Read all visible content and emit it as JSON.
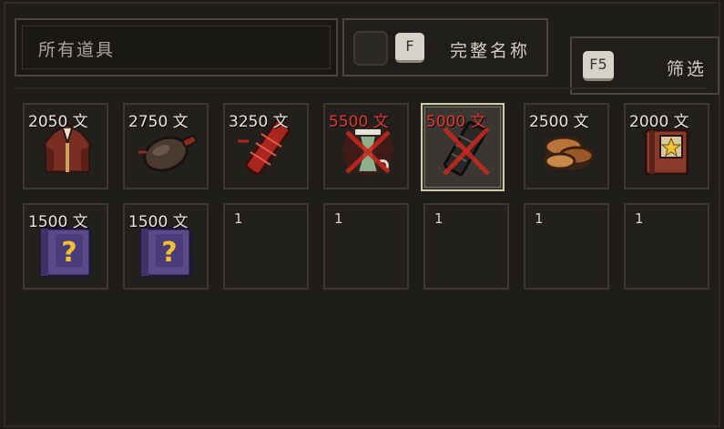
{
  "search": {
    "text": "所有道具"
  },
  "full_name": {
    "key": "F",
    "label": "完整名称"
  },
  "screen_filter": {
    "key": "F5",
    "label": "筛选"
  },
  "items": [
    {
      "price": "2050 文",
      "affordable": true,
      "icon": "robe-icon"
    },
    {
      "price": "2750 文",
      "affordable": true,
      "icon": "meat-icon"
    },
    {
      "price": "3250 文",
      "affordable": true,
      "icon": "red-scroll-icon"
    },
    {
      "price": "5500 文",
      "affordable": false,
      "icon": "urn-icon"
    },
    {
      "price": "5000 文",
      "affordable": false,
      "icon": "ink-stick-icon",
      "selected": true
    },
    {
      "price": "2500 文",
      "affordable": true,
      "icon": "mushroom-icon"
    },
    {
      "price": "2000 文",
      "affordable": true,
      "icon": "star-book-icon"
    },
    {
      "price": "1500 文",
      "affordable": true,
      "icon": "mystery-book-icon"
    },
    {
      "price": "1500 文",
      "affordable": true,
      "icon": "mystery-book-icon"
    },
    {
      "count": "1"
    },
    {
      "count": "1"
    },
    {
      "count": "1"
    },
    {
      "count": "1"
    },
    {
      "count": "1"
    }
  ],
  "colors": {
    "unaffordable_price": "#e0382e",
    "price": "#eae6dc",
    "selected_border": "#d4c9a6"
  }
}
